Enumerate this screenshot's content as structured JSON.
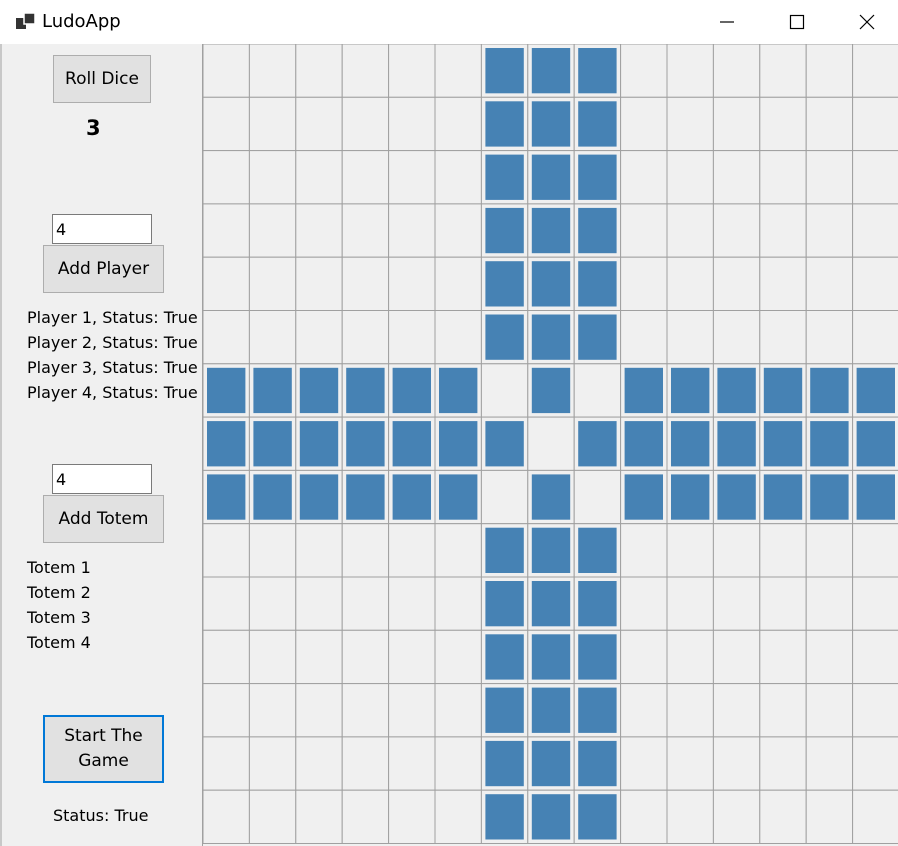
{
  "window": {
    "title": "LudoApp",
    "icon": "app-window-icon",
    "controls": [
      "minimize-icon",
      "maximize-icon",
      "close-icon"
    ]
  },
  "controls": {
    "roll_dice_label": "Roll Dice",
    "dice_value": "3",
    "player_count_value": "4",
    "add_player_label": "Add Player",
    "players": [
      "Player 1, Status: True",
      "Player 2, Status: True",
      "Player 3, Status: True",
      "Player 4, Status: True"
    ],
    "totem_count_value": "4",
    "add_totem_label": "Add Totem",
    "totems": [
      "Totem 1",
      "Totem 2",
      "Totem 3",
      "Totem 4"
    ],
    "start_label": "Start The Game",
    "status_text": "Status: True"
  },
  "board": {
    "columns": 15,
    "rows": 15,
    "cell_fill_color": "#4682b4",
    "grid_line_color": "#a0a0a0",
    "background_color": "#f0f0f0",
    "center_empty_cells": [
      [
        6,
        6
      ],
      [
        6,
        8
      ],
      [
        7,
        7
      ],
      [
        8,
        6
      ],
      [
        8,
        8
      ]
    ]
  }
}
